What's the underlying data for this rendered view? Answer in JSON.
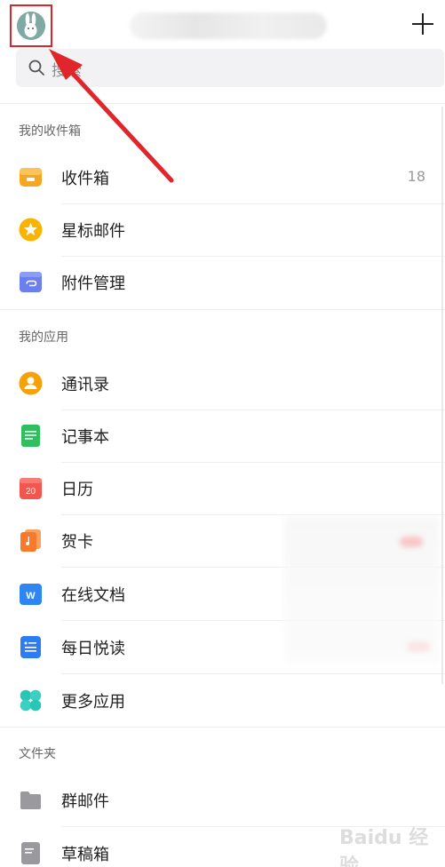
{
  "search": {
    "placeholder": "搜索"
  },
  "sections": {
    "inbox_group": "我的收件箱",
    "apps_group": "我的应用",
    "folders_group": "文件夹"
  },
  "inbox_items": [
    {
      "label": "收件箱",
      "count": "18",
      "icon": "inbox-icon"
    },
    {
      "label": "星标邮件",
      "icon": "star-icon"
    },
    {
      "label": "附件管理",
      "icon": "attachment-icon"
    }
  ],
  "app_items": [
    {
      "label": "通讯录",
      "icon": "contacts-icon"
    },
    {
      "label": "记事本",
      "icon": "notebook-icon"
    },
    {
      "label": "日历",
      "icon": "calendar-icon",
      "icon_text": "20"
    },
    {
      "label": "贺卡",
      "icon": "greeting-card-icon"
    },
    {
      "label": "在线文档",
      "icon": "online-doc-icon",
      "icon_text": "W"
    },
    {
      "label": "每日悦读",
      "icon": "daily-reading-icon"
    },
    {
      "label": "更多应用",
      "icon": "more-apps-icon"
    }
  ],
  "folder_items": [
    {
      "label": "群邮件",
      "icon": "folder-icon"
    },
    {
      "label": "草稿箱",
      "icon": "drafts-icon"
    }
  ],
  "watermark": "Baidu 经验",
  "colors": {
    "highlight": "#d9262b",
    "inbox": "#f5a623",
    "star": "#f8b400",
    "attachment": "#6b7ff0",
    "contacts": "#f5a20a",
    "notebook": "#2fbf5f",
    "calendar": "#f2564e",
    "card": "#f77a2c",
    "doc": "#2f86f2",
    "reading": "#2c7cf2",
    "more": "#27c6b6",
    "folder": "#9a9a9e"
  }
}
